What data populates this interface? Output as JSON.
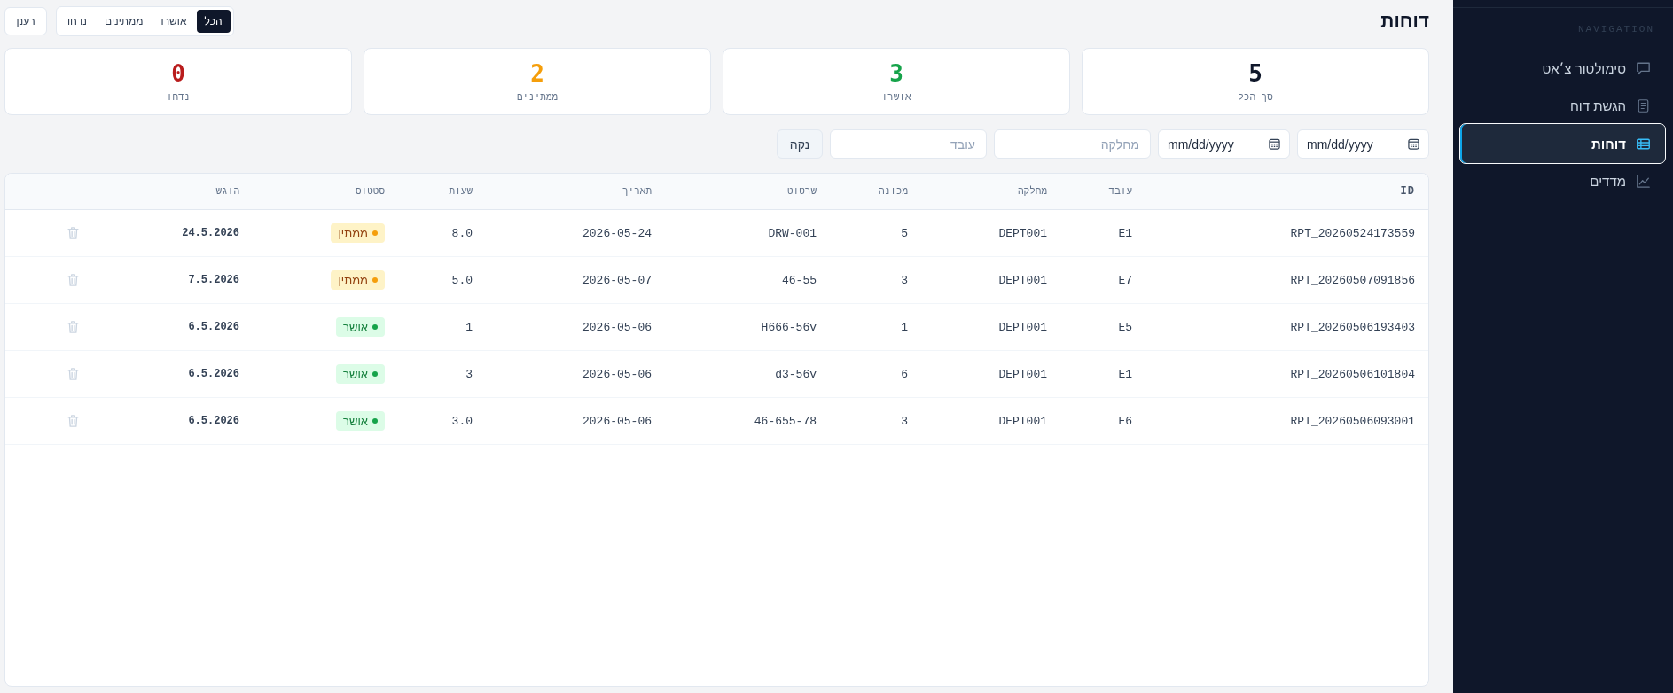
{
  "header": {
    "title": "דוחות",
    "refresh_button": "רענן",
    "tabs": [
      {
        "label": "הכל",
        "selected": true
      },
      {
        "label": "אושרו",
        "selected": false
      },
      {
        "label": "ממתינים",
        "selected": false
      },
      {
        "label": "נדחו",
        "selected": false
      }
    ]
  },
  "stats": [
    {
      "value": "5",
      "label": "סך הכל",
      "color": "#0f172a"
    },
    {
      "value": "3",
      "label": "אושרו",
      "color": "#16a34a"
    },
    {
      "value": "2",
      "label": "ממתינים",
      "color": "#f59e0b"
    },
    {
      "value": "0",
      "label": "נדחו",
      "color": "#b91c1c"
    }
  ],
  "filters": {
    "fields": [
      {
        "kind": "date",
        "placeholder": "mm/dd/yyyy"
      },
      {
        "kind": "date",
        "placeholder": "mm/dd/yyyy"
      },
      {
        "kind": "text",
        "placeholder": "מחלקה"
      },
      {
        "kind": "text",
        "placeholder": "עובד"
      }
    ],
    "clear_button": "נקה"
  },
  "table": {
    "columns": [
      "ID",
      "עובד",
      "מחלקה",
      "מכונה",
      "שרטוט",
      "תאריך",
      "שעות",
      "סטטוס",
      "הוגש"
    ],
    "rows": [
      {
        "id": "RPT_20260524173559",
        "employee": "E1",
        "department": "DEPT001",
        "machine": "5",
        "drawing": "DRW-001",
        "date": "2026-05-24",
        "hours": "8.0",
        "status": {
          "kind": "pending",
          "label": "ממתין",
          "color": "#f59e0b"
        },
        "submitted": "24.5.2026"
      },
      {
        "id": "RPT_20260507091856",
        "employee": "E7",
        "department": "DEPT001",
        "machine": "3",
        "drawing": "46-55",
        "date": "2026-05-07",
        "hours": "5.0",
        "status": {
          "kind": "pending",
          "label": "ממתין",
          "color": "#f59e0b"
        },
        "submitted": "7.5.2026"
      },
      {
        "id": "RPT_20260506193403",
        "employee": "E5",
        "department": "DEPT001",
        "machine": "1",
        "drawing": "H666-56v",
        "date": "2026-05-06",
        "hours": "1",
        "status": {
          "kind": "approved",
          "label": "אושר",
          "color": "#16a34a"
        },
        "submitted": "6.5.2026"
      },
      {
        "id": "RPT_20260506101804",
        "employee": "E1",
        "department": "DEPT001",
        "machine": "6",
        "drawing": "d3-56v",
        "date": "2026-05-06",
        "hours": "3",
        "status": {
          "kind": "approved",
          "label": "אושר",
          "color": "#16a34a"
        },
        "submitted": "6.5.2026"
      },
      {
        "id": "RPT_20260506093001",
        "employee": "E6",
        "department": "DEPT001",
        "machine": "3",
        "drawing": "46-655-78",
        "date": "2026-05-06",
        "hours": "3.0",
        "status": {
          "kind": "approved",
          "label": "אושר",
          "color": "#16a34a"
        },
        "submitted": "6.5.2026"
      }
    ]
  },
  "sidebar": {
    "section_label": "NAVIGATION",
    "items": [
      {
        "label": "סימולטור צ׳אט",
        "selected": false
      },
      {
        "label": "הגשת דוח",
        "selected": false
      },
      {
        "label": "דוחות",
        "selected": true
      },
      {
        "label": "מדדים",
        "selected": false
      }
    ]
  }
}
